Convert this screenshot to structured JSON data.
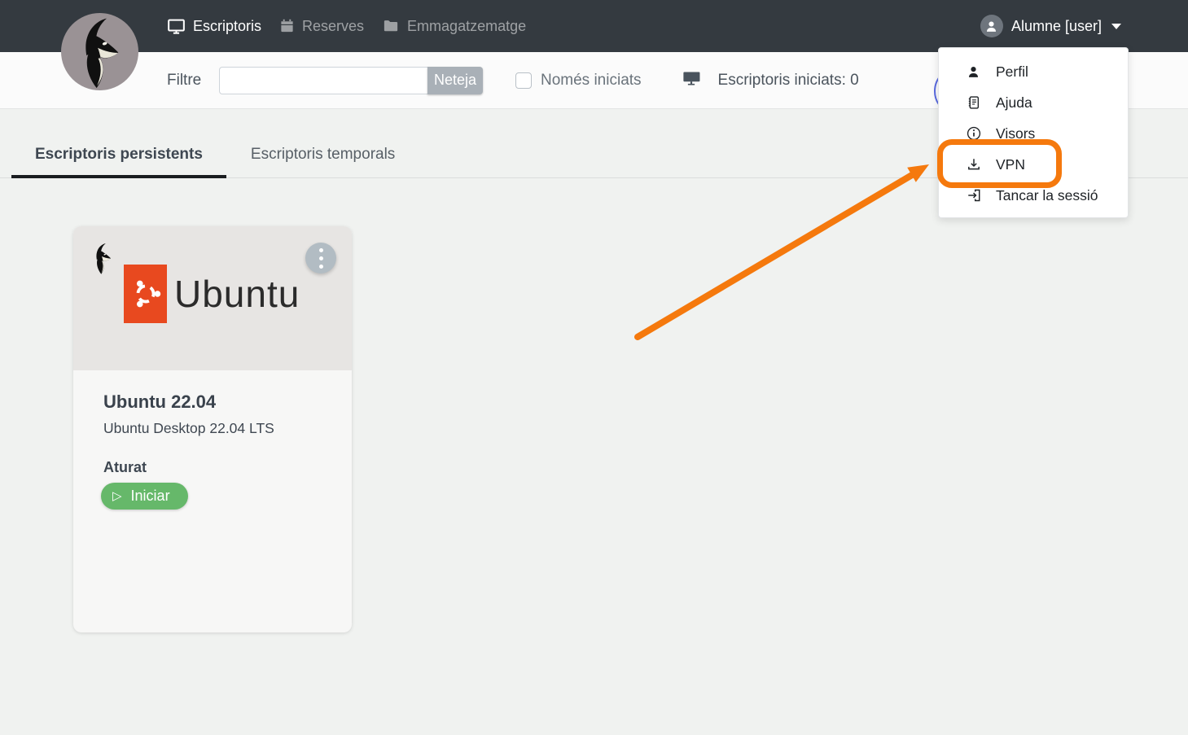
{
  "navbar": {
    "brand_icon": "isard-logo",
    "items": [
      {
        "label": "Escriptoris",
        "icon": "display-icon",
        "active": true
      },
      {
        "label": "Reserves",
        "icon": "calendar-icon",
        "active": false
      },
      {
        "label": "Emmagatzematge",
        "icon": "folder-icon",
        "active": false
      }
    ],
    "user": {
      "label": "Alumne [user]",
      "icon": "person-icon"
    }
  },
  "filter_bar": {
    "label": "Filtre",
    "input_value": "",
    "clear_button": "Neteja",
    "only_started_label": "Només iniciats",
    "only_started_checked": false,
    "started_label": "Escriptoris iniciats:",
    "started_count": "0"
  },
  "tabs": [
    {
      "label": "Escriptoris persistents",
      "active": true
    },
    {
      "label": "Escriptoris temporals",
      "active": false
    }
  ],
  "desktop_card": {
    "os_logo_text": "Ubuntu",
    "title": "Ubuntu 22.04",
    "description": "Ubuntu Desktop 22.04 LTS",
    "status": "Aturat",
    "start_button": "Iniciar",
    "play_glyph": "▷"
  },
  "user_menu": {
    "items": [
      {
        "label": "Perfil",
        "icon": "person-icon"
      },
      {
        "label": "Ajuda",
        "icon": "journal-icon"
      },
      {
        "label": "Visors",
        "icon": "info-circle-icon"
      },
      {
        "label": "VPN",
        "icon": "download-icon",
        "highlighted": true
      },
      {
        "label": "Tancar la sessió",
        "icon": "logout-icon"
      }
    ]
  },
  "colors": {
    "navbar_bg": "#343a40",
    "annotation_orange": "#f5790d",
    "start_green": "#66b86a",
    "ubuntu_orange": "#e8491f",
    "logo_circle_grey": "#9a9295",
    "page_bg": "#f0f2f0"
  }
}
